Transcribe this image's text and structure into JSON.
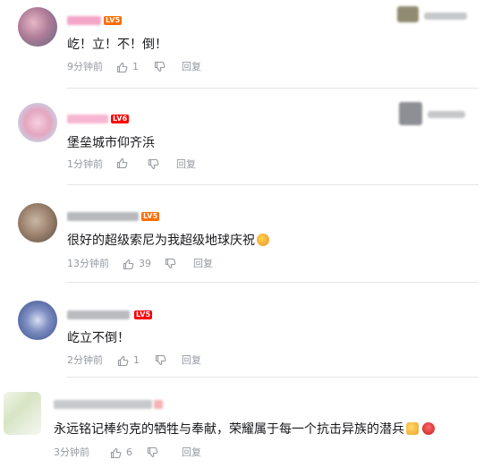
{
  "comments": [
    {
      "level": "LV5",
      "text": "屹！立！不！倒！",
      "time": "9分钟前",
      "likes": "1",
      "reply": "回复"
    },
    {
      "level": "LV6",
      "text": "堡垒城市仰齐浜",
      "time": "1分钟前",
      "likes": "",
      "reply": "回复"
    },
    {
      "level": "LV5",
      "text": "很好的超级索尼为我超级地球庆祝",
      "time": "13分钟前",
      "likes": "39",
      "reply": "回复"
    },
    {
      "level": "LV5",
      "text": "屹立不倒！",
      "time": "2分钟前",
      "likes": "1",
      "reply": "回复"
    },
    {
      "level": "",
      "text": "永远铭记棒约克的牺牲与奉献，荣耀属于每一个抗击异族的潜兵",
      "time": "3分钟前",
      "likes": "6",
      "reply": "回复"
    }
  ],
  "colors": {
    "text": "#18191c",
    "meta": "#9499a0",
    "lv5": "#ff6c00",
    "lv6": "#ff0000",
    "divider": "#e3e5e7"
  },
  "icons": [
    "thumb-up-icon",
    "thumb-down-icon",
    "party-emoji-icon",
    "fist-emoji-icon",
    "angry-emoji-icon"
  ]
}
